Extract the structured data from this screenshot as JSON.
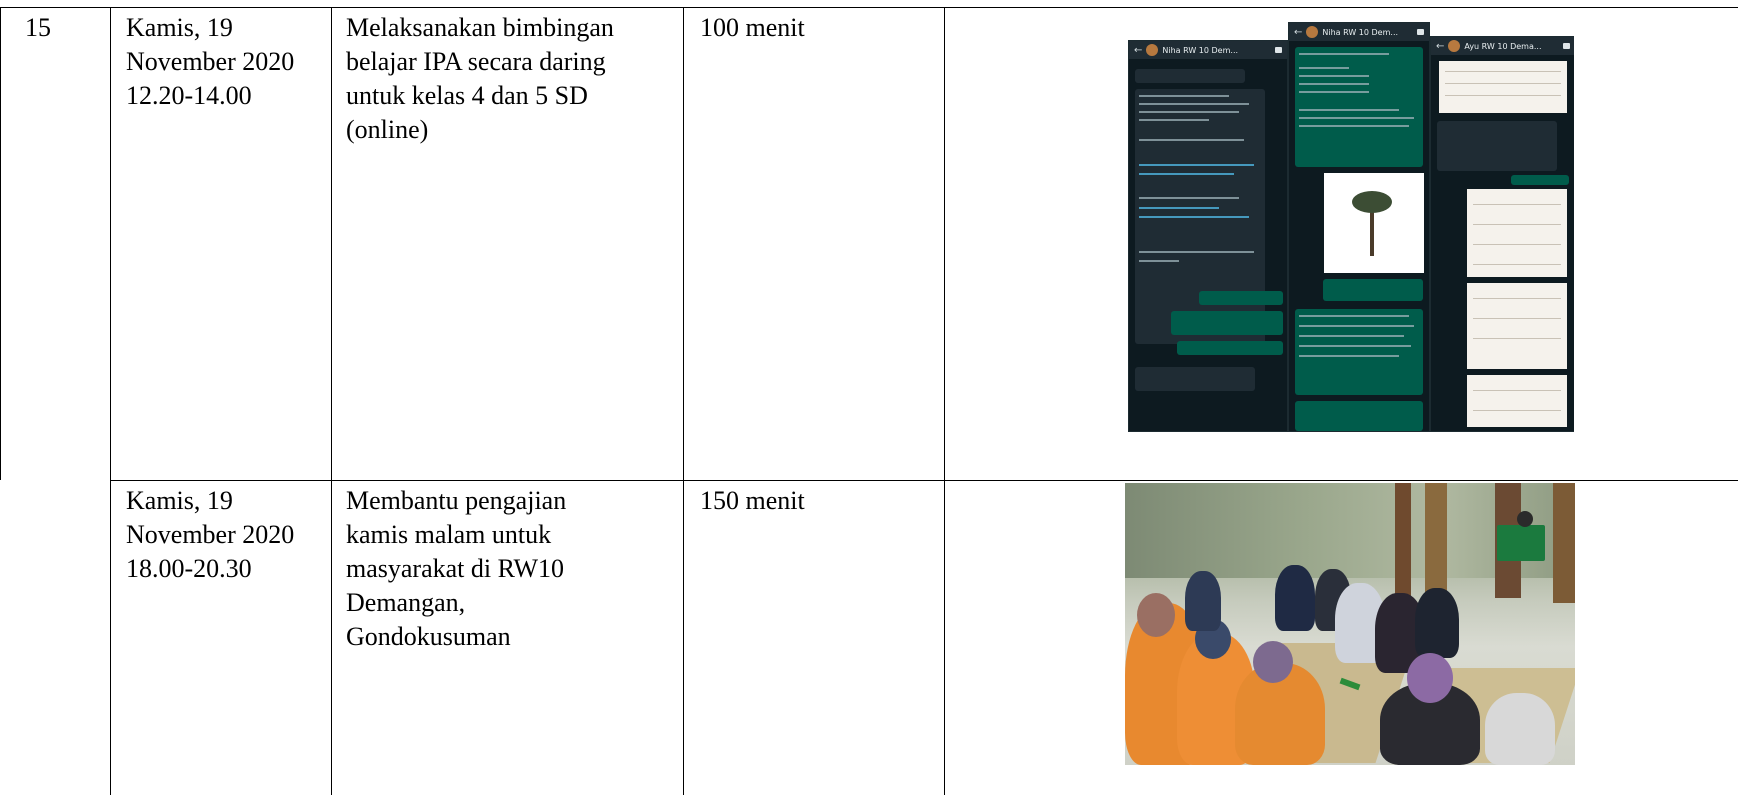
{
  "table": {
    "row_number": "15",
    "rows": [
      {
        "date": "Kamis, 19\nNovember 2020\n12.20-14.00",
        "activity": "Melaksanakan bimbingan\nbelajar IPA secara daring\nuntuk kelas 4 dan 5 SD\n(online)",
        "duration": "100 menit"
      },
      {
        "date": "Kamis, 19\nNovember 2020\n18.00-20.30",
        "activity": "Membantu pengajian\nkamis malam untuk\nmasyarakat di RW10\nDemangan,\nGondokusuman",
        "duration": "150 menit"
      }
    ]
  },
  "evidence": {
    "chat_collage": {
      "panel_titles": [
        "Niha RW 10 Dem...",
        "Niha RW 10 Dem...",
        "Ayu RW 10 Dema..."
      ]
    },
    "mosque_photo": {}
  },
  "colors": {
    "border": "#000000",
    "chat_bg": "#0d1a20",
    "chat_in_bubble": "#1f2c34",
    "chat_out_bubble": "#005c4b",
    "mosque_wall": "#a9b39c",
    "attendee_shirt": "#e8892f"
  }
}
